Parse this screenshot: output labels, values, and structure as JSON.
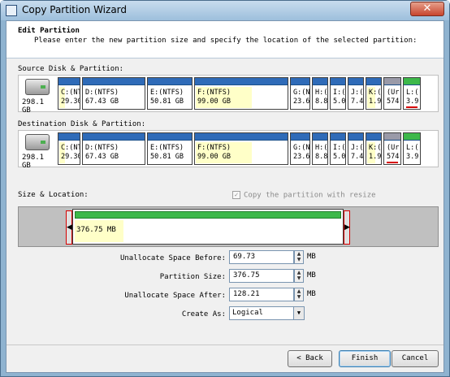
{
  "window": {
    "title": "Copy Partition Wizard",
    "close_label": "✕"
  },
  "header": {
    "title": "Edit Partition",
    "subtitle": "Please enter the new partition size and specify the location of the selected partition:"
  },
  "source": {
    "label": "Source Disk & Partition:",
    "disk_size": "298.1 GB",
    "partitions": [
      {
        "name": "C:(NT",
        "size": "29.30",
        "bar": "blue"
      },
      {
        "name": "D:(NTFS)",
        "size": "67.43 GB",
        "bar": "blue"
      },
      {
        "name": "E:(NTFS)",
        "size": "50.81 GB",
        "bar": "blue"
      },
      {
        "name": "F:(NTFS)",
        "size": "99.00 GB",
        "bar": "blue"
      },
      {
        "name": "G:(N",
        "size": "23.6",
        "bar": "blue"
      },
      {
        "name": "H:(",
        "size": "8.8",
        "bar": "blue"
      },
      {
        "name": "I:(",
        "size": "5.0",
        "bar": "blue"
      },
      {
        "name": "J:(",
        "size": "7.4",
        "bar": "blue"
      },
      {
        "name": "K:(",
        "size": "1.9",
        "bar": "blue"
      },
      {
        "name": "(Ur",
        "size": "574",
        "bar": "gray"
      },
      {
        "name": "L:(",
        "size": "3.9",
        "bar": "green"
      }
    ]
  },
  "destination": {
    "label": "Destination Disk & Partition:",
    "disk_size": "298.1 GB",
    "partitions": [
      {
        "name": "C:(NT",
        "size": "29.30",
        "bar": "blue"
      },
      {
        "name": "D:(NTFS)",
        "size": "67.43 GB",
        "bar": "blue"
      },
      {
        "name": "E:(NTFS)",
        "size": "50.81 GB",
        "bar": "blue"
      },
      {
        "name": "F:(NTFS)",
        "size": "99.00 GB",
        "bar": "blue"
      },
      {
        "name": "G:(N",
        "size": "23.6",
        "bar": "blue"
      },
      {
        "name": "H:(",
        "size": "8.8",
        "bar": "blue"
      },
      {
        "name": "I:(",
        "size": "5.0",
        "bar": "blue"
      },
      {
        "name": "J:(",
        "size": "7.4",
        "bar": "blue"
      },
      {
        "name": "K:(",
        "size": "1.9",
        "bar": "blue"
      },
      {
        "name": "(Ur",
        "size": "574",
        "bar": "gray"
      },
      {
        "name": "L:(",
        "size": "3.9",
        "bar": "green"
      }
    ]
  },
  "size_location": {
    "label": "Size & Location:",
    "copy_resize_label": "Copy the partition with resize",
    "partition_text": "376.75 MB"
  },
  "form": {
    "before_label": "Unallocate Space Before:",
    "before_value": "69.73",
    "size_label": "Partition Size:",
    "size_value": "376.75",
    "after_label": "Unallocate Space After:",
    "after_value": "128.21",
    "unit": "MB",
    "create_as_label": "Create As:",
    "create_as_value": "Logical"
  },
  "buttons": {
    "back": "< Back",
    "finish": "Finish",
    "cancel": "Cancel"
  },
  "colors": {
    "partition_blue": "#2f6bb8",
    "used_yellow": "#ffffc8",
    "free_green": "#3db84a",
    "unallocated_gray": "#9a9aa8",
    "selection_red": "#d60000"
  }
}
